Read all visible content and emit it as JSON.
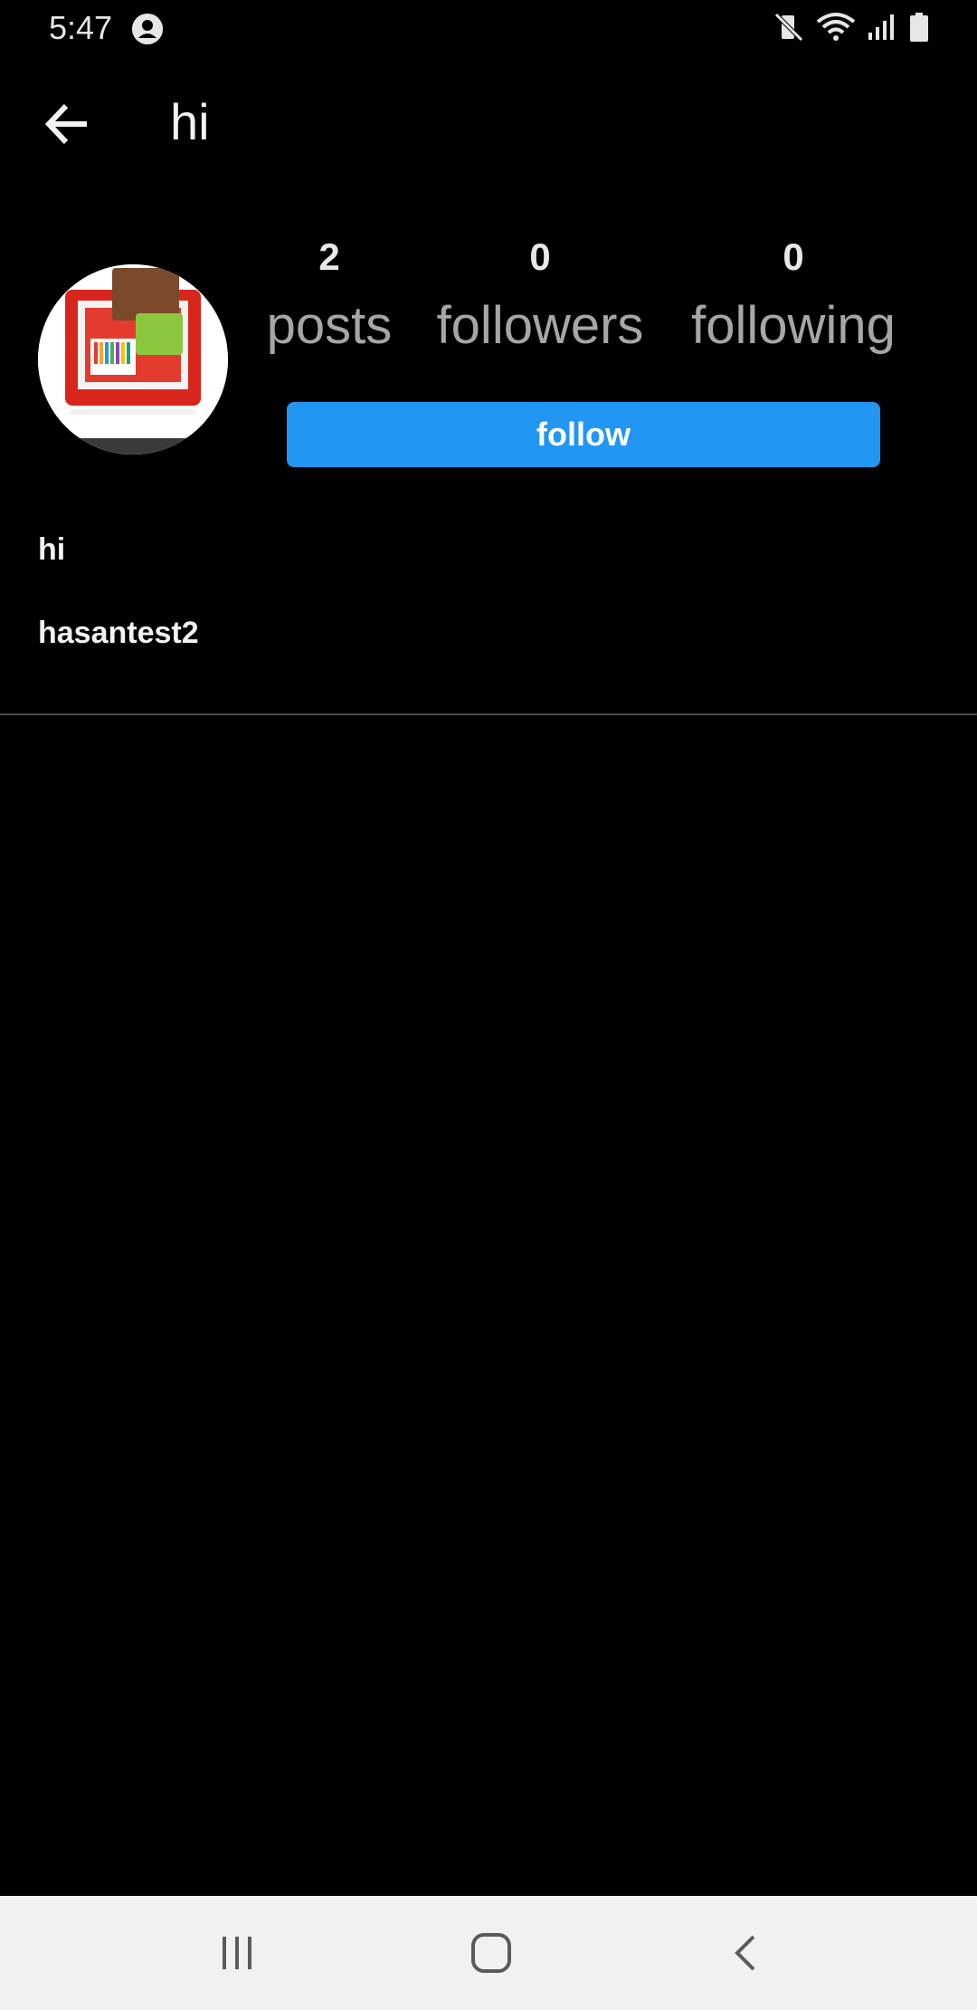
{
  "status_bar": {
    "time": "5:47",
    "icons": [
      "account-circle-icon",
      "vibrate-mute-icon",
      "wifi-icon",
      "signal-icon",
      "battery-icon"
    ]
  },
  "toolbar": {
    "back_icon": "arrow-left-icon",
    "title": "hi"
  },
  "profile": {
    "avatar_icon": "profile-picture",
    "stats": [
      {
        "count": "2",
        "label": "posts"
      },
      {
        "count": "0",
        "label": "followers"
      },
      {
        "count": "0",
        "label": "following"
      }
    ],
    "follow_label": "follow",
    "name": "hi",
    "username": "hasantest2"
  },
  "nav_bar": {
    "icons": [
      "recent-apps-icon",
      "home-icon",
      "back-icon"
    ]
  },
  "colors": {
    "background": "#000000",
    "accent": "#2196f3",
    "secondary_text": "#a6a6a6",
    "nav_background": "#f1f1f1"
  }
}
